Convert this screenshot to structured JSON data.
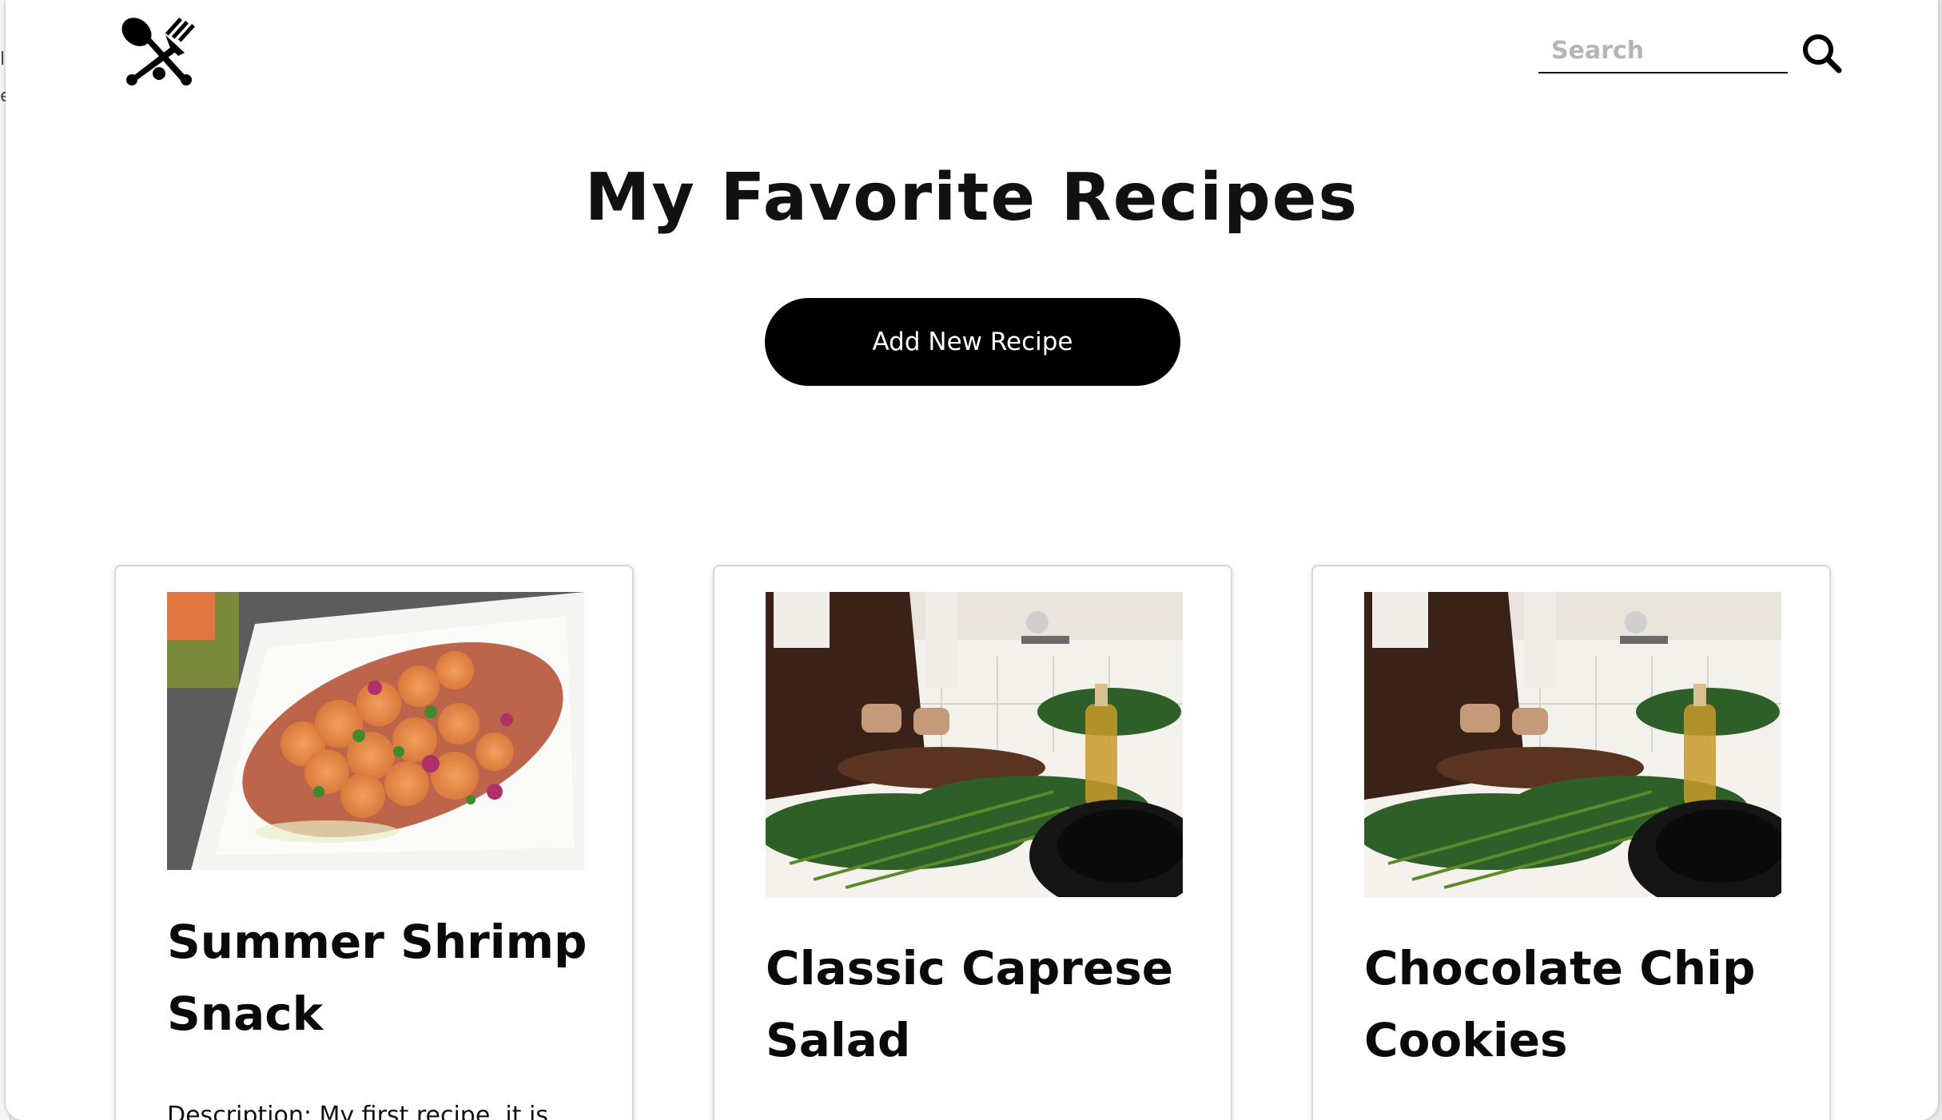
{
  "header": {
    "logo_icon": "fork-and-spoon-crossed-icon",
    "search": {
      "placeholder": "Search",
      "value": "",
      "button_icon": "search-icon"
    }
  },
  "main": {
    "title": "My Favorite Recipes",
    "add_button_label": "Add New Recipe"
  },
  "recipes": [
    {
      "title_line1": "Summer Shrimp",
      "title_line2": "Snack",
      "description": "Description: My first recipe, it is",
      "image": "grilled-shrimp-platter-photo"
    },
    {
      "title_line1": "Classic Caprese",
      "title_line2": "Salad",
      "image": "kitchen-chopping-vegetables-photo"
    },
    {
      "title_line1": "Chocolate Chip",
      "title_line2": "Cookies",
      "image": "kitchen-chopping-vegetables-photo"
    }
  ],
  "colors": {
    "primary_button": "#000000",
    "text": "#111111",
    "card_border": "#d8d8d8"
  }
}
